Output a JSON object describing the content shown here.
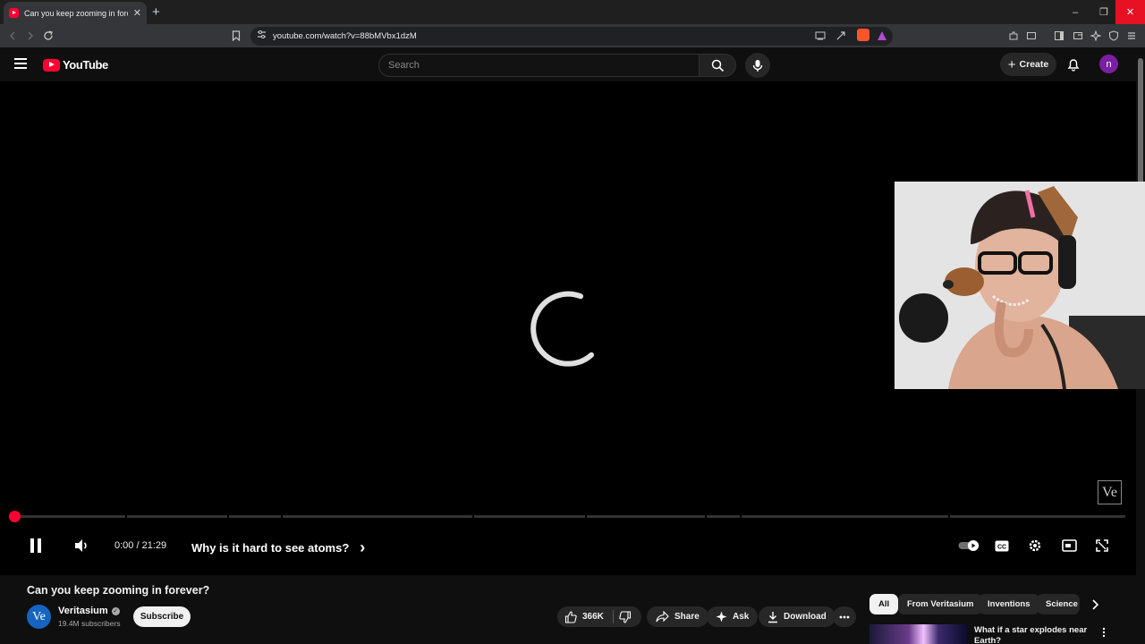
{
  "browser": {
    "tab_title": "Can you keep zooming in forever",
    "new_tab": "+",
    "url": "youtube.com/watch?v=88bMVbx1dzM",
    "minimize": "–",
    "restore": "❐",
    "close": "✕"
  },
  "masthead": {
    "logo_text": "YouTube",
    "search_placeholder": "Search",
    "create_label": "Create",
    "create_plus": "+",
    "avatar_letter": "n"
  },
  "player": {
    "watermark": "Ve",
    "time": "0:00 / 21:29",
    "chapter": "Why is it hard to see atoms?",
    "chapter_arrow": "›",
    "progress": 0.0
  },
  "video": {
    "title": "Can you keep zooming in forever?",
    "channel_name": "Veritasium",
    "channel_initials": "Ve",
    "verified_mark": "✓",
    "subscribers": "19.4M subscribers",
    "subscribe_label": "Subscribe",
    "likes": "366K",
    "share_label": "Share",
    "ask_label": "Ask",
    "download_label": "Download"
  },
  "chips": [
    "All",
    "From Veritasium",
    "Inventions",
    "Science"
  ],
  "recommendation": {
    "title": "What if a star explodes near Earth?"
  },
  "colors": {
    "accent": "#ff0033",
    "background": "#0f0f0f",
    "avatar": "#7b1fa2"
  }
}
